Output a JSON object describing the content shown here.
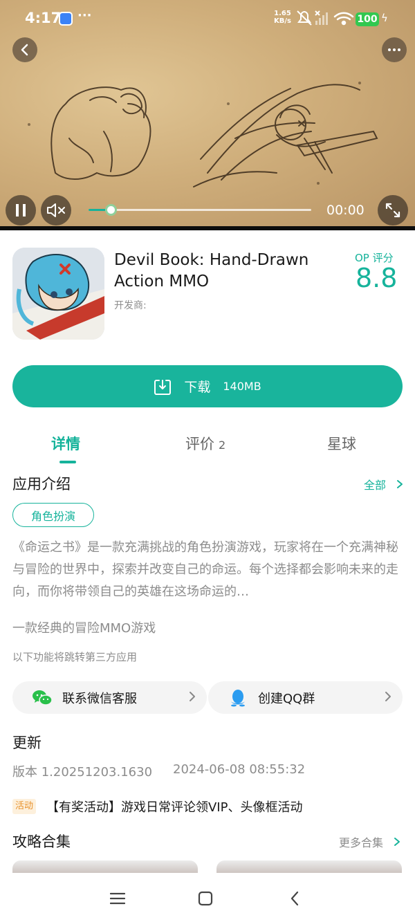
{
  "status_bar": {
    "time": "4:17",
    "net_speed_value": "1.65",
    "net_speed_unit": "KB/s",
    "battery": "100"
  },
  "video": {
    "time": "00:00",
    "progress": 0.1,
    "accent_color": "#16b39b"
  },
  "app": {
    "title": "Devil Book: Hand-Drawn Action MMO",
    "developer_label": "开发商:",
    "score_label": "OP 评分",
    "score": "8.8"
  },
  "download": {
    "label": "下载",
    "size": "140MB"
  },
  "tabs": [
    {
      "label": "详情",
      "count": ""
    },
    {
      "label": "评价",
      "count": "2"
    },
    {
      "label": "星球",
      "count": ""
    }
  ],
  "intro": {
    "title": "应用介绍",
    "all_link": "全部",
    "tag": "角色扮演",
    "description": "《命运之书》是一款充满挑战的角色扮演游戏，玩家将在一个充满神秘与冒险的世界中，探索并改变自己的命运。每个选择都会影响未来的走向，而你将带领自己的英雄在这场命运的…",
    "tagline": "一款经典的冒险MMO游戏",
    "third_party_note": "以下功能将跳转第三方应用"
  },
  "contacts": {
    "wechat_label": "联系微信客服",
    "qq_label": "创建QQ群"
  },
  "update": {
    "title": "更新",
    "version": "版本 1.20251203.1630",
    "date": "2024-06-08 08:55:32",
    "badge": "活动",
    "activity": "【有奖活动】游戏日常评论领VIP、头像框活动"
  },
  "guides": {
    "title": "攻略合集",
    "more_link": "更多合集"
  }
}
